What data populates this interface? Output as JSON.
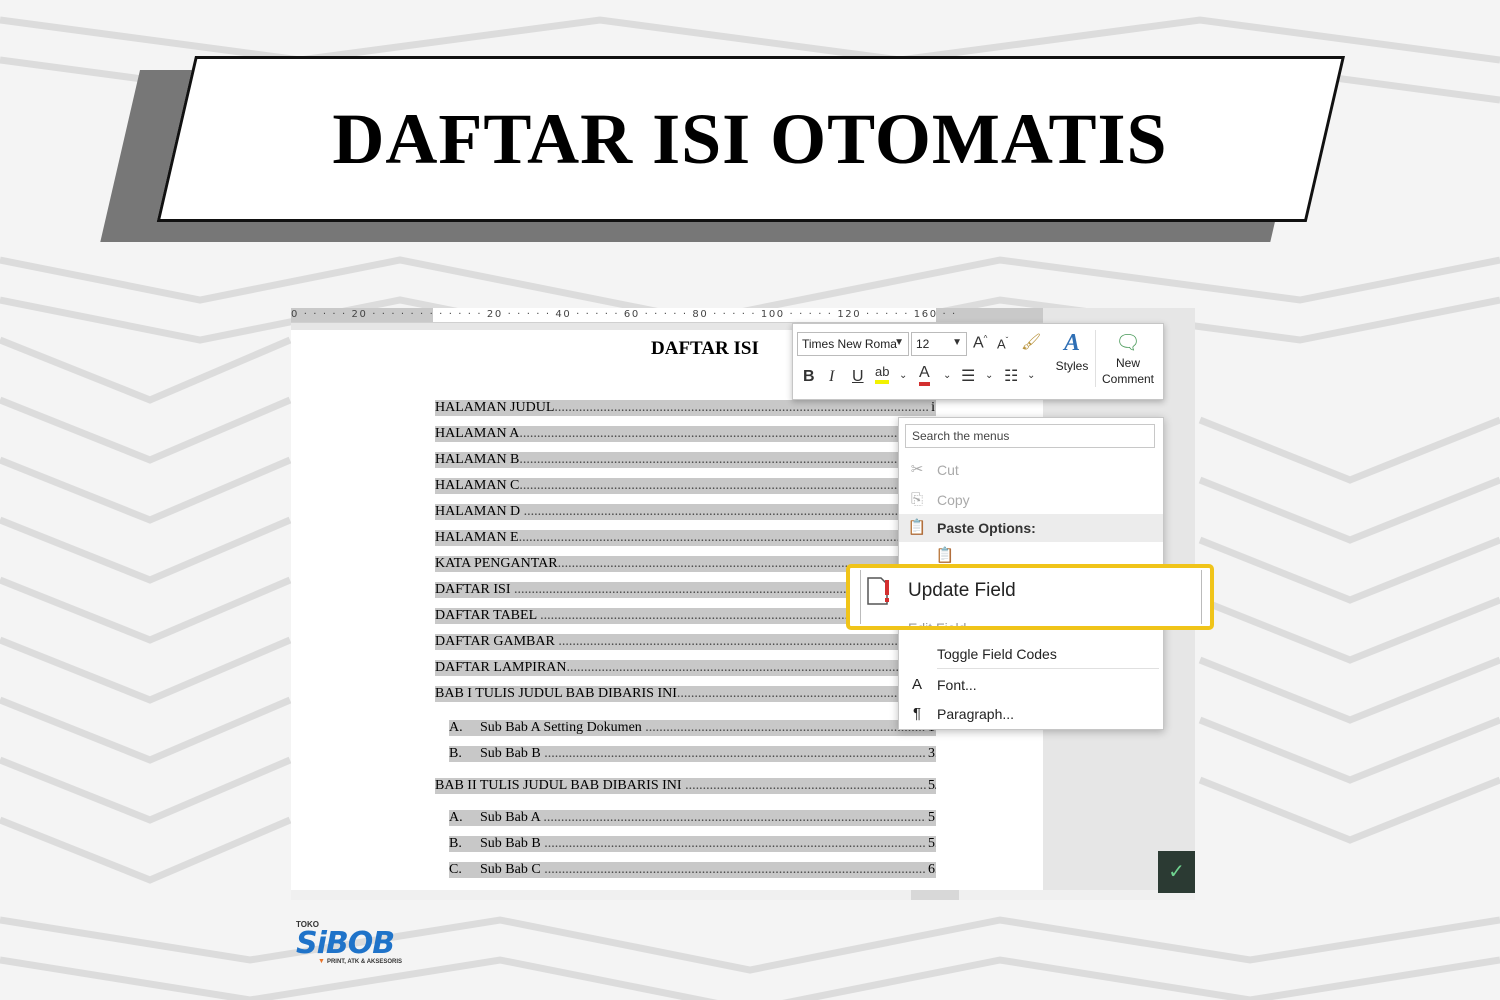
{
  "banner": {
    "title": "DAFTAR ISI OTOMATIS"
  },
  "ruler": {
    "ticks": "0 · · · · · 20 · · · · · · · · · · · · 20 · · · · · 40 · · · · · 60 · · · · · 80 · · · · · 100 · · · · · 120 · · · · · 160 · ·"
  },
  "document": {
    "heading": "DAFTAR ISI",
    "toc": [
      {
        "text": "HALAMAN JUDUL",
        "page": "i"
      },
      {
        "text": "HALAMAN A",
        "page": ""
      },
      {
        "text": "HALAMAN B",
        "page": ""
      },
      {
        "text": "HALAMAN C",
        "page": ""
      },
      {
        "text": "HALAMAN D ",
        "page": ""
      },
      {
        "text": "HALAMAN E",
        "page": ""
      },
      {
        "text": "KATA  PENGANTAR",
        "page": ""
      },
      {
        "text": "DAFTAR ISI ",
        "page": ""
      },
      {
        "text": "DAFTAR TABEL ",
        "page": ""
      },
      {
        "text": "DAFTAR GAMBAR ",
        "page": ""
      },
      {
        "text": "DAFTAR LAMPIRAN",
        "page": ""
      },
      {
        "text": "BAB I  TULIS JUDUL BAB DIBARIS INI",
        "page": ""
      },
      {
        "letter": "A.",
        "text": "Sub Bab A Setting Dokumen ",
        "page": "1"
      },
      {
        "letter": "B.",
        "text": "Sub Bab B ",
        "page": "3"
      },
      {
        "text": "BAB II TULIS JUDUL BAB DIBARIS INI ",
        "page": "5"
      },
      {
        "letter": "A.",
        "text": "Sub Bab A ",
        "page": "5"
      },
      {
        "letter": "B.",
        "text": "Sub Bab B ",
        "page": "5"
      },
      {
        "letter": "C.",
        "text": "Sub Bab C ",
        "page": "6"
      }
    ]
  },
  "mini_toolbar": {
    "font_name": "Times New Roma",
    "font_size": "12",
    "bold": "B",
    "italic": "I",
    "underline": "U",
    "grow_font": "A",
    "shrink_font": "A",
    "styles_label": "Styles",
    "new_comment_label_1": "New",
    "new_comment_label_2": "Comment"
  },
  "context_menu": {
    "search_placeholder": "Search the menus",
    "cut": "Cut",
    "copy": "Copy",
    "paste_options": "Paste Options:",
    "update_field": "Update Field",
    "edit_field": "Edit Field...",
    "toggle_field_codes": "Toggle Field Codes",
    "font": "Font...",
    "paragraph": "Paragraph..."
  },
  "logo": {
    "top": "TOKO",
    "name": "SiBOB",
    "tagline": "PRINT, ATK & AKSESORIS"
  },
  "colors": {
    "highlight": "#f0c419",
    "toc_shading": "#c8c8c8",
    "logo_blue": "#1f73c9",
    "accept_green": "#6fd38f"
  }
}
